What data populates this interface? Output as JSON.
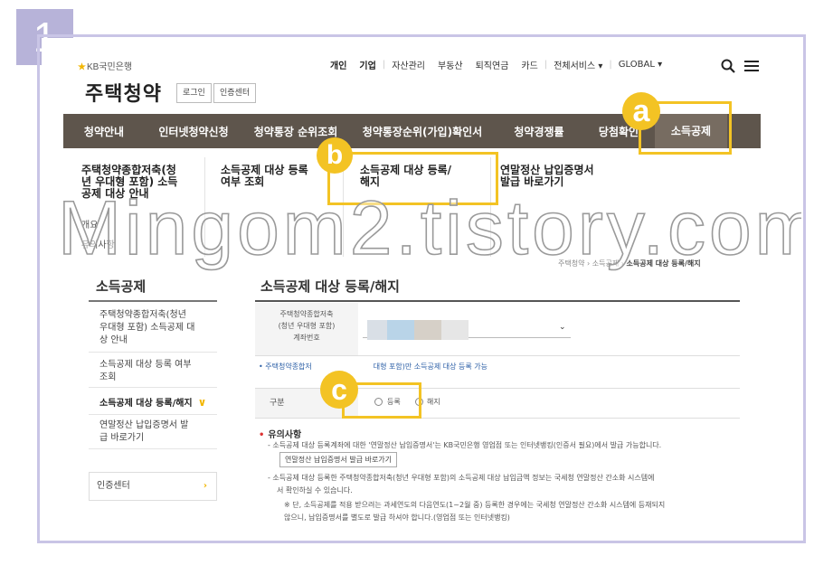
{
  "step_number": "1",
  "header": {
    "bank_logo": "KB국민은행",
    "site_title": "주택청약",
    "login_button": "로그인",
    "cert_button": "인증센터",
    "util_links": [
      "개인",
      "기업",
      "자산관리",
      "부동산",
      "퇴직연금",
      "카드",
      "전체서비스 ▾",
      "GLOBAL ▾"
    ]
  },
  "gnb": {
    "items": [
      "청약안내",
      "인터넷청약신청",
      "청약통장 순위조회",
      "청약통장순위(가입)확인서",
      "청약경쟁률",
      "당첨확인",
      "소득공제"
    ]
  },
  "submenu": {
    "col1_title": "주택청약종합저축(청년 우대형 포함) 소득공제 대상 안내",
    "col1_line1": "주택청약종합저축(청",
    "col1_line2": "년 우대형 포함) 소득",
    "col1_line3": "공제 대상 안내",
    "col1_sub1": "개요",
    "col1_sub2": "유의사항",
    "col2_line1": "소득공제 대상 등록",
    "col2_line2": "여부 조회",
    "col3_line1": "소득공제 대상 등록/",
    "col3_line2": "해지",
    "col4_line1": "연말정산 납입증명서",
    "col4_line2": "발급 바로가기"
  },
  "watermark": "Mingom2.tistory.com",
  "breadcrumb": [
    "주택청약",
    "소득공제",
    "소득공제 대상 등록/해지"
  ],
  "lnb": {
    "title": "소득공제",
    "item1_line1": "주택청약종합저축(청년",
    "item1_line2": "우대형 포함) 소득공제 대",
    "item1_line3": "상 안내",
    "item2_line1": "소득공제 대상 등록 여부",
    "item2_line2": "조회",
    "item3": "소득공제 대상 등록/해지",
    "item4_line1": "연말정산 납입증명서 발",
    "item4_line2": "급 바로가기",
    "cert_center": "인증센터"
  },
  "main": {
    "title": "소득공제 대상 등록/해지",
    "account_label_1": "주택청약종합저축",
    "account_label_2": "(청년 우대형 포함)",
    "account_label_3": "계좌번호",
    "notice_a": "• 주택청약종합저",
    "notice_b": "대형 포함)만 소득공제 대상 등록 가능",
    "div_label": "구분",
    "radio_register": "등록",
    "radio_cancel": "해지",
    "caution_title": "유의사항",
    "p1": "- 소득공제 대상 등록계좌에 대한 '연말정산 납입증명서'는 KB국민은행 영업점 또는 인터넷뱅킹(인증서 필요)에서 발급 가능합니다.",
    "issue_button": "연말정산 납입증명서 발급 바로가기",
    "p2_line1": "- 소득공제 대상 등록한 주택청약종합저축(청년 우대형 포함)의 소득공제 대상 납입금액 정보는 국세청 연말정산 간소화 시스템에",
    "p2_line2": "서 확인하실 수 있습니다.",
    "p3_line1": "※ 단, 소득공제를 적용 받으려는 과세연도의 다음연도(1~2월 중) 등록한 경우에는 국세청 연말정산 간소화 시스템에 등재되지",
    "p3_line2": "않으니, 납입증명서를 별도로 발급 하셔야 합니다.(영업점 또는 인터넷뱅킹)"
  },
  "annotations": {
    "a": "a",
    "b": "b",
    "c": "c"
  },
  "colors": {
    "gnb_bg": "#5e554c",
    "gnb_active": "#776c61",
    "annotation": "#f3c324",
    "frame": "#c9c5e6",
    "badge": "#b7b3d9",
    "link_blue": "#2a5ea6"
  }
}
